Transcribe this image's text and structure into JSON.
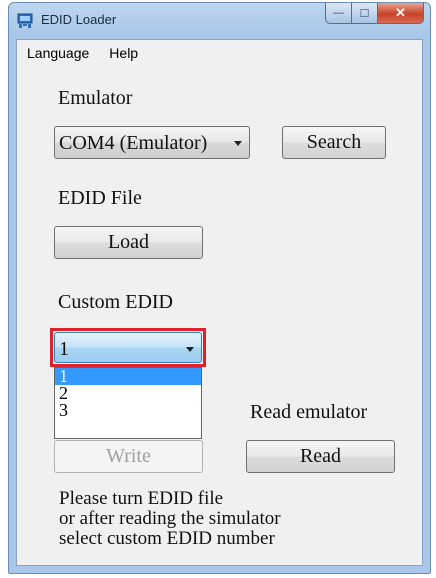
{
  "window": {
    "title": "EDID Loader",
    "caption": {
      "minimize": "—",
      "maximize": "☐",
      "close": "✕"
    }
  },
  "menu": [
    "Language",
    "Help"
  ],
  "emulator": {
    "label": "Emulator",
    "selected": "COM4 (Emulator)",
    "search_label": "Search"
  },
  "edid_file": {
    "label": "EDID File",
    "load_label": "Load"
  },
  "custom_edid": {
    "label": "Custom EDID",
    "selected": "1",
    "options": [
      "1",
      "2",
      "3"
    ],
    "highlight_color": "#e0202a"
  },
  "actions": {
    "read_emulator_label": "Read emulator",
    "write_label": "Write",
    "read_label": "Read"
  },
  "info_lines": [
    "Please turn EDID file",
    "or after reading the simulator",
    "select custom EDID number"
  ],
  "colors": {
    "selection": "#3399ff",
    "close_button": "#c7432a"
  }
}
